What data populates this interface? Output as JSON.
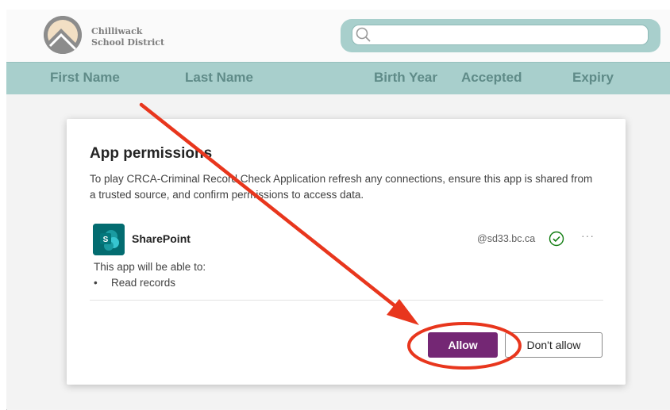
{
  "app": {
    "logo_line1": "Chilliwack",
    "logo_line2": "School District"
  },
  "search": {
    "placeholder": ""
  },
  "table": {
    "columns": [
      "First Name",
      "Last Name",
      "Birth Year",
      "Accepted",
      "Expiry"
    ]
  },
  "dialog": {
    "title": "App permissions",
    "description": "To play CRCA-Criminal Record Check Application refresh any connections, ensure this app is shared from a trusted source, and confirm permissions to access data.",
    "connection": {
      "name": "SharePoint",
      "account": "@sd33.bc.ca",
      "icon": "sharepoint-icon",
      "status_icon": "check-circle-icon",
      "more": "···"
    },
    "able_to_label": "This app will be able to:",
    "permissions": [
      "Read records"
    ],
    "allow_label": "Allow",
    "deny_label": "Don't allow"
  },
  "colors": {
    "header_teal": "#a8cfcc",
    "header_text": "#5f8b88",
    "allow_purple": "#742774",
    "sharepoint_teal": "#036c70",
    "annotation_red": "#e8361d"
  }
}
